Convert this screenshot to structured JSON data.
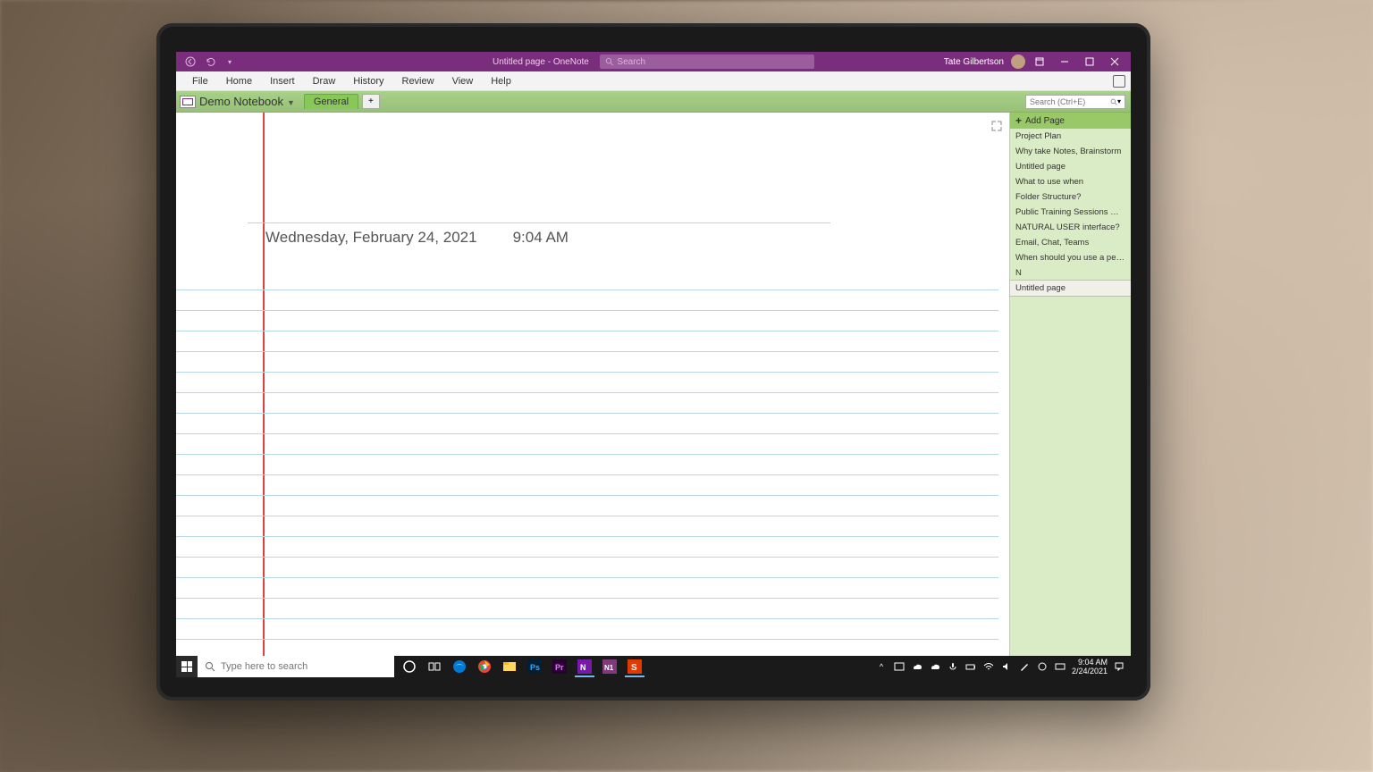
{
  "titlebar": {
    "doc_title": "Untitled page",
    "app_name": "OneNote",
    "full_title": "Untitled page  -  OneNote",
    "search_placeholder": "Search",
    "user_name": "Tate Gilbertson"
  },
  "ribbon": {
    "tabs": [
      "File",
      "Home",
      "Insert",
      "Draw",
      "History",
      "Review",
      "View",
      "Help"
    ]
  },
  "notebook": {
    "name": "Demo Notebook",
    "sections": [
      "General"
    ],
    "page_search_placeholder": "Search (Ctrl+E)"
  },
  "canvas": {
    "date": "Wednesday, February 24, 2021",
    "time": "9:04 AM"
  },
  "page_panel": {
    "add_label": "Add Page",
    "pages": [
      "Project Plan",
      "Why take Notes, Brainstorm",
      "Untitled page",
      "What to use when",
      "Folder Structure?",
      "Public Training Sessions Worksho",
      "NATURAL USER interface?",
      "Email, Chat, Teams",
      "When should you use a pen?",
      "N",
      "Untitled page"
    ],
    "selected_index": 10
  },
  "taskbar": {
    "search_placeholder": "Type here to search",
    "time": "9:04 AM",
    "date": "2/24/2021",
    "apps": [
      "cortana",
      "task-view",
      "edge",
      "chrome",
      "explorer",
      "photoshop",
      "premiere",
      "onenote-app",
      "onenote-desktop",
      "snagit"
    ],
    "active_apps": [
      "onenote-app",
      "snagit"
    ]
  },
  "colors": {
    "accent": "#7b2d7d",
    "section_green": "#98c868",
    "panel_green": "#daecc5"
  }
}
